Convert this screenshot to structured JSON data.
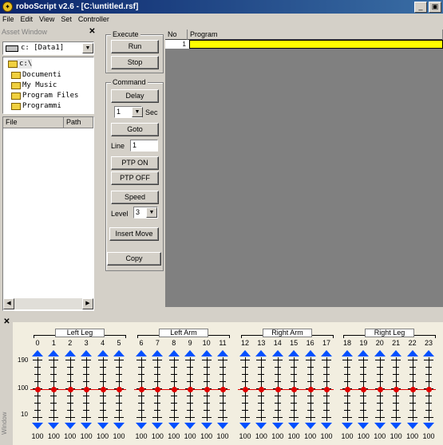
{
  "window": {
    "app_icon_glyph": "✦",
    "title": "roboScript v2.6 - [C:\\untitled.rsf]",
    "minimize_glyph": "_",
    "maximize_glyph": "▣"
  },
  "menu": [
    "File",
    "Edit",
    "View",
    "Set",
    "Controller"
  ],
  "asset_window": {
    "title": "Asset Window",
    "close_glyph": "✕",
    "drive": "c: [Data1]",
    "dropdown_glyph": "▼",
    "directories": [
      {
        "label": "c:\\",
        "indent": 0
      },
      {
        "label": "Documenti",
        "indent": 1
      },
      {
        "label": "My Music",
        "indent": 1
      },
      {
        "label": "Program Files",
        "indent": 1
      },
      {
        "label": "Programmi",
        "indent": 1
      }
    ],
    "file_columns": [
      "File",
      "Path"
    ],
    "scroll_left_glyph": "◀",
    "scroll_right_glyph": "▶"
  },
  "execute": {
    "label": "Execute",
    "run": "Run",
    "stop": "Stop"
  },
  "command": {
    "label": "Command",
    "delay": "Delay",
    "delay_value": "1",
    "delay_unit": "Sec",
    "goto": "Goto",
    "line_label": "Line",
    "line_value": "1",
    "ptp_on": "PTP ON",
    "ptp_off": "PTP OFF",
    "speed": "Speed",
    "level_label": "Level",
    "level_value": "3",
    "insert_move": "Insert Move",
    "copy": "Copy"
  },
  "program_grid": {
    "col_no": "No",
    "col_program": "Program",
    "rows": [
      {
        "no": "1",
        "program": ""
      }
    ],
    "highlight_color": "#ffff00"
  },
  "slider_panel": {
    "close_glyph": "✕",
    "title": "Window",
    "scale_top": "190",
    "scale_mid": "100",
    "scale_bottom": "10",
    "groups": [
      {
        "label": "Left Leg",
        "channels": [
          "0",
          "1",
          "2",
          "3",
          "4",
          "5"
        ]
      },
      {
        "label": "Left Arm",
        "channels": [
          "6",
          "7",
          "8",
          "9",
          "10",
          "11"
        ]
      },
      {
        "label": "Right Arm",
        "channels": [
          "12",
          "13",
          "14",
          "15",
          "16",
          "17"
        ]
      },
      {
        "label": "Right Leg",
        "channels": [
          "18",
          "19",
          "20",
          "21",
          "22",
          "23"
        ]
      }
    ],
    "values": [
      "100",
      "100",
      "100",
      "100",
      "100",
      "100",
      "100",
      "100",
      "100",
      "100",
      "100",
      "100",
      "100",
      "100",
      "100",
      "100",
      "100",
      "100",
      "100",
      "100",
      "100",
      "100",
      "100",
      "100"
    ],
    "arrow_color": "#0050ff",
    "knob_color": "#e00000"
  }
}
